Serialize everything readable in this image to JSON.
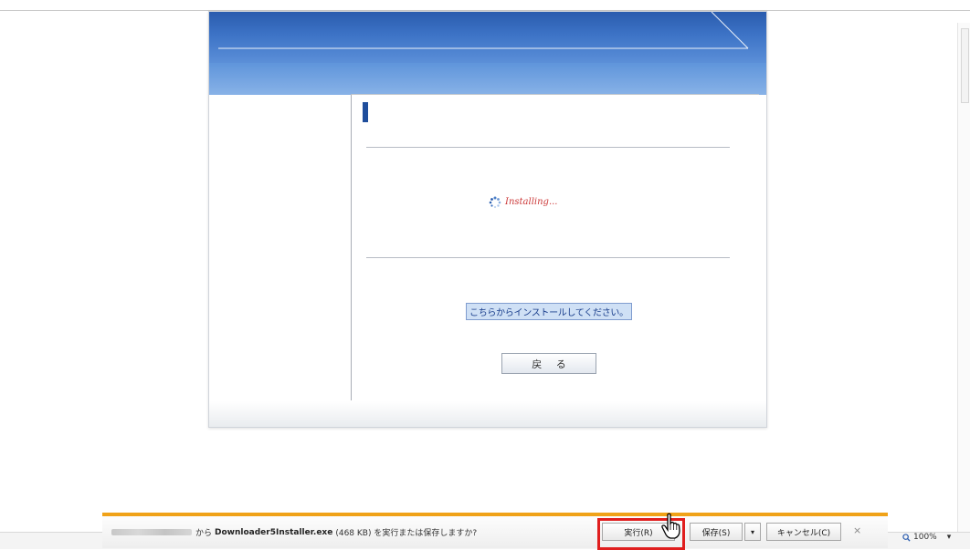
{
  "page": {
    "installing_text": "Installing...",
    "install_link": "こちらからインストールしてください。",
    "back_button": "戻 る"
  },
  "download_bar": {
    "message_prefix": "から",
    "file_name": "Downloader5Installer.exe",
    "message_suffix": "(468 KB) を実行または保存しますか?",
    "run_button": "実行(R)",
    "save_button": "保存(S)",
    "save_dropdown": "▾",
    "cancel_button": "キャンセル(C)",
    "close": "×"
  },
  "status_bar": {
    "zoom": "100%",
    "zoom_dropdown": "▾"
  },
  "colors": {
    "accent_orange": "#f0a218",
    "highlight_red": "#e01e1e",
    "banner_blue": "#2a5cae"
  }
}
